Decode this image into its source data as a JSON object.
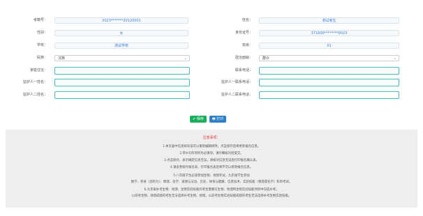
{
  "form": {
    "exam_id_label": "考籍号：",
    "exam_id_value": "2023*******20120001",
    "name_label": "姓名：",
    "name_value": "测试考生",
    "gender_label": "性别：",
    "gender_value": "女",
    "id_card_label": "身份证号：",
    "id_card_value": "371600********0023",
    "school_label": "学校：",
    "school_value": "测试学校",
    "class_label": "班级：",
    "class_value": "01",
    "nation_label": "民族：",
    "nation_value": "汉族",
    "political_label": "政治面貌：",
    "political_value": "群众",
    "address_label": "家庭住址：",
    "contact_label": "联系电话：",
    "guardian1_label": "监护人一姓名：",
    "guardian1_phone_label": "监护人一联系电话：",
    "guardian2_label": "监护人二姓名：",
    "guardian2_phone_label": "监护人二联系电话："
  },
  "buttons": {
    "save": "✔ 保存",
    "print": "🖶 打印"
  },
  "notice": {
    "title": "注意事项：",
    "lines": [
      "1.本页面中信息如有误可以重新编辑修改，点击保存后将更新报名信息。",
      "2.带※号的项目为必填项，请仔细核对后提交。",
      "3.点击保存，表示确定信息无误，请核对信息无误后打印报名确认表。",
      "4.请妥善保存报名表，打印报名表后将不可以修改报名信息。",
      "5.八年级学生必须参加生物、地理考试，九年级学生参加",
      "数学、英语（含听力）、物理、化学、道德与法治、历史、体育与健康、信息技术、实验技能（物理或化学）科目考试。",
      "6.九年级补考生物、地理、生物实验技能的考生需要在生物、地理和生物实验技能项目中勾选补考。",
      "以前考生物、地理成绩的考生无法选择补考生物、地理，以前考生物实验技能成绩的考生无法选择补考生物实验技能。"
    ]
  }
}
